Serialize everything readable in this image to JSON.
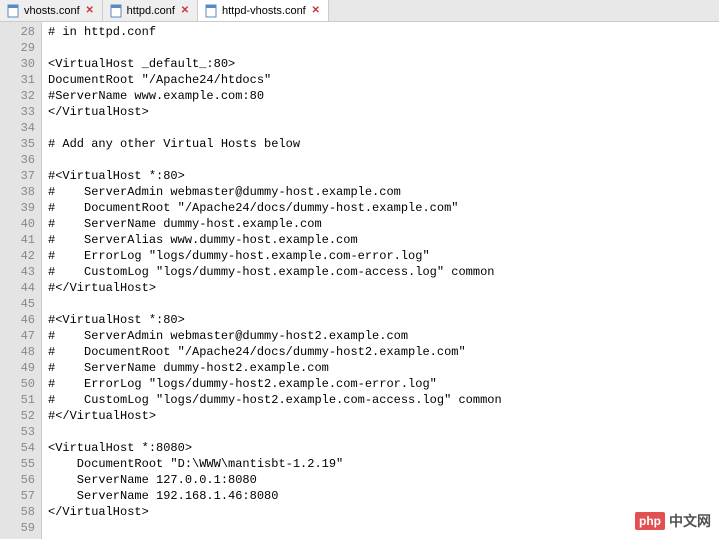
{
  "tabs": [
    {
      "label": "vhosts.conf",
      "active": false
    },
    {
      "label": "httpd.conf",
      "active": false
    },
    {
      "label": "httpd-vhosts.conf",
      "active": true
    }
  ],
  "startLine": 28,
  "code": [
    "# in httpd.conf",
    "",
    "<VirtualHost _default_:80>",
    "DocumentRoot \"/Apache24/htdocs\"",
    "#ServerName www.example.com:80",
    "</VirtualHost>",
    "",
    "# Add any other Virtual Hosts below",
    "",
    "#<VirtualHost *:80>",
    "#    ServerAdmin webmaster@dummy-host.example.com",
    "#    DocumentRoot \"/Apache24/docs/dummy-host.example.com\"",
    "#    ServerName dummy-host.example.com",
    "#    ServerAlias www.dummy-host.example.com",
    "#    ErrorLog \"logs/dummy-host.example.com-error.log\"",
    "#    CustomLog \"logs/dummy-host.example.com-access.log\" common",
    "#</VirtualHost>",
    "",
    "#<VirtualHost *:80>",
    "#    ServerAdmin webmaster@dummy-host2.example.com",
    "#    DocumentRoot \"/Apache24/docs/dummy-host2.example.com\"",
    "#    ServerName dummy-host2.example.com",
    "#    ErrorLog \"logs/dummy-host2.example.com-error.log\"",
    "#    CustomLog \"logs/dummy-host2.example.com-access.log\" common",
    "#</VirtualHost>",
    "",
    "<VirtualHost *:8080>",
    "    DocumentRoot \"D:\\WWW\\mantisbt-1.2.19\"",
    "    ServerName 127.0.0.1:8080",
    "    ServerName 192.168.1.46:8080",
    "</VirtualHost>",
    ""
  ],
  "watermark": {
    "logo": "php",
    "text": "中文网"
  }
}
